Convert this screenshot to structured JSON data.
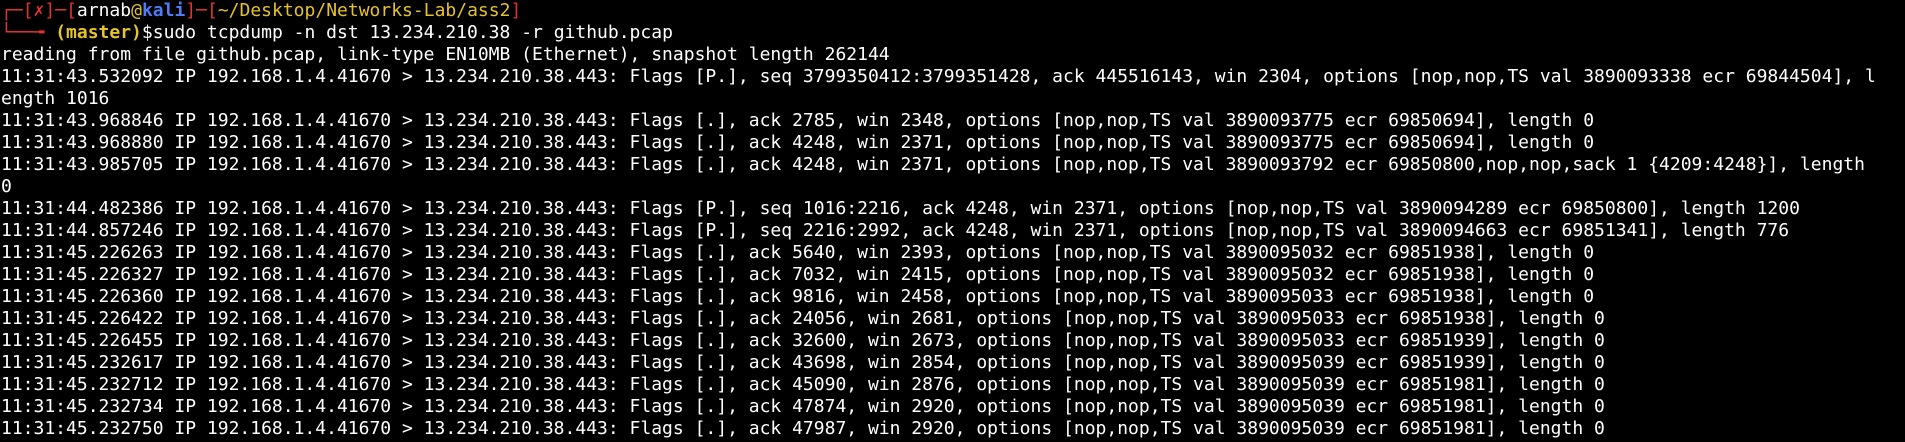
{
  "colors": {
    "background": "#000000",
    "text": "#ffffff",
    "prompt_frame": "#e2332c",
    "prompt_user": "#4d7cf6",
    "prompt_branch": "#e6c229"
  },
  "prompt": {
    "corner_top": "┌─",
    "bracket_open": "[",
    "status": "✗",
    "bracket_close": "]",
    "dash": "─",
    "user": "arnab",
    "at": "@",
    "host": "kali",
    "path": "~/Desktop/Networks-Lab/ass2",
    "corner_bottom": "└──╼ ",
    "branch": "(master)",
    "dollar": "$",
    "command": "sudo tcpdump -n dst 13.234.210.38 -r github.pcap"
  },
  "output_lines": [
    "reading from file github.pcap, link-type EN10MB (Ethernet), snapshot length 262144",
    "11:31:43.532092 IP 192.168.1.4.41670 > 13.234.210.38.443: Flags [P.], seq 3799350412:3799351428, ack 445516143, win 2304, options [nop,nop,TS val 3890093338 ecr 69844504], l",
    "ength 1016",
    "11:31:43.968846 IP 192.168.1.4.41670 > 13.234.210.38.443: Flags [.], ack 2785, win 2348, options [nop,nop,TS val 3890093775 ecr 69850694], length 0",
    "11:31:43.968880 IP 192.168.1.4.41670 > 13.234.210.38.443: Flags [.], ack 4248, win 2371, options [nop,nop,TS val 3890093775 ecr 69850694], length 0",
    "11:31:43.985705 IP 192.168.1.4.41670 > 13.234.210.38.443: Flags [.], ack 4248, win 2371, options [nop,nop,TS val 3890093792 ecr 69850800,nop,nop,sack 1 {4209:4248}], length",
    "0",
    "11:31:44.482386 IP 192.168.1.4.41670 > 13.234.210.38.443: Flags [P.], seq 1016:2216, ack 4248, win 2371, options [nop,nop,TS val 3890094289 ecr 69850800], length 1200",
    "11:31:44.857246 IP 192.168.1.4.41670 > 13.234.210.38.443: Flags [P.], seq 2216:2992, ack 4248, win 2371, options [nop,nop,TS val 3890094663 ecr 69851341], length 776",
    "11:31:45.226263 IP 192.168.1.4.41670 > 13.234.210.38.443: Flags [.], ack 5640, win 2393, options [nop,nop,TS val 3890095032 ecr 69851938], length 0",
    "11:31:45.226327 IP 192.168.1.4.41670 > 13.234.210.38.443: Flags [.], ack 7032, win 2415, options [nop,nop,TS val 3890095032 ecr 69851938], length 0",
    "11:31:45.226360 IP 192.168.1.4.41670 > 13.234.210.38.443: Flags [.], ack 9816, win 2458, options [nop,nop,TS val 3890095033 ecr 69851938], length 0",
    "11:31:45.226422 IP 192.168.1.4.41670 > 13.234.210.38.443: Flags [.], ack 24056, win 2681, options [nop,nop,TS val 3890095033 ecr 69851938], length 0",
    "11:31:45.226455 IP 192.168.1.4.41670 > 13.234.210.38.443: Flags [.], ack 32600, win 2673, options [nop,nop,TS val 3890095033 ecr 69851939], length 0",
    "11:31:45.232617 IP 192.168.1.4.41670 > 13.234.210.38.443: Flags [.], ack 43698, win 2854, options [nop,nop,TS val 3890095039 ecr 69851939], length 0",
    "11:31:45.232712 IP 192.168.1.4.41670 > 13.234.210.38.443: Flags [.], ack 45090, win 2876, options [nop,nop,TS val 3890095039 ecr 69851981], length 0",
    "11:31:45.232734 IP 192.168.1.4.41670 > 13.234.210.38.443: Flags [.], ack 47874, win 2920, options [nop,nop,TS val 3890095039 ecr 69851981], length 0",
    "11:31:45.232750 IP 192.168.1.4.41670 > 13.234.210.38.443: Flags [.], ack 47987, win 2920, options [nop,nop,TS val 3890095039 ecr 69851981], length 0"
  ]
}
